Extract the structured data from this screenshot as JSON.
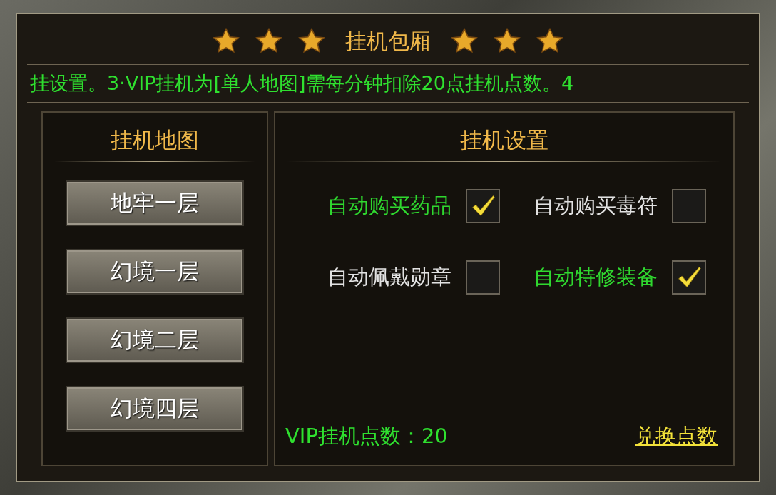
{
  "window": {
    "title": "挂机包厢"
  },
  "marquee": "挂设置。3·VIP挂机为[单人地图]需每分钟扣除20点挂机点数。4",
  "map_panel": {
    "title": "挂机地图",
    "buttons": [
      "地牢一层",
      "幻境一层",
      "幻境二层",
      "幻境四层"
    ]
  },
  "settings_panel": {
    "title": "挂机设置",
    "options": [
      {
        "label": "自动购买药品",
        "checked": true
      },
      {
        "label": "自动购买毒符",
        "checked": false
      },
      {
        "label": "自动佩戴勋章",
        "checked": false
      },
      {
        "label": "自动特修装备",
        "checked": true
      }
    ],
    "points_label": "VIP挂机点数：20",
    "exchange_link": "兑换点数"
  }
}
